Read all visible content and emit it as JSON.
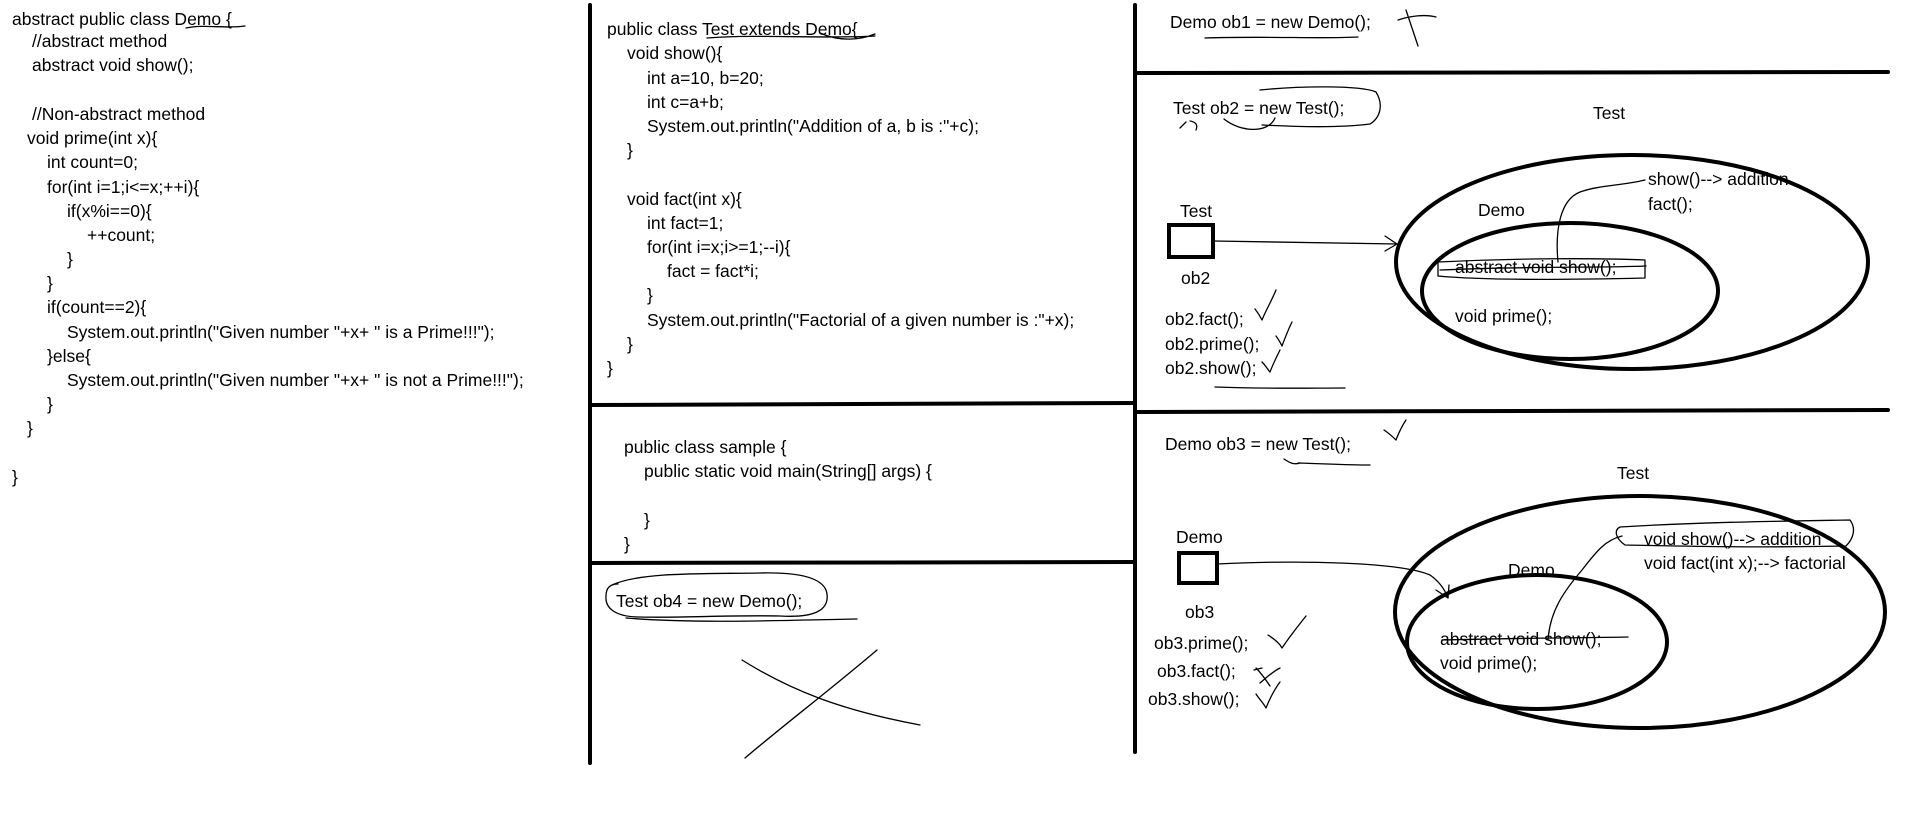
{
  "code_abstract_demo": [
    "abstract public class Demo {",
    "//abstract method",
    "abstract void show();",
    "//Non-abstract method",
    "void prime(int x){",
    "int count=0;",
    "for(int i=1;i<=x;++i){",
    "if(x%i==0){",
    "++count;",
    "}",
    "}",
    "if(count==2){",
    "System.out.println(\"Given number \"+x+ \" is a Prime!!!\");",
    "}else{",
    "System.out.println(\"Given number \"+x+ \" is not a Prime!!!\");",
    "}",
    "}",
    "}"
  ],
  "code_test_class": [
    "public class Test extends Demo{",
    "void show(){",
    "int a=10, b=20;",
    "int c=a+b;",
    "System.out.println(\"Addition of a, b is :\"+c);",
    "}",
    "void fact(int x){",
    "int fact=1;",
    "for(int i=x;i>=1;--i){",
    "fact = fact*i;",
    "}",
    "System.out.println(\"Factorial of a given number is :\"+x);",
    "}",
    "}"
  ],
  "code_sample_class": [
    "public class sample {",
    "public static void main(String[] args) {",
    "}",
    "}"
  ],
  "ob4_statement": "Test ob4 = new Demo();",
  "ob1_statement": "Demo ob1 = new Demo();",
  "ob2_section": {
    "statement": "Test ob2 = new Test();",
    "outer_label": "Test",
    "ref_type": "Test",
    "ref_name": "ob2",
    "inner_label": "Demo",
    "outer_methods": [
      "show()--> addition",
      "fact();"
    ],
    "inner_methods": [
      "abstract void show();",
      "void prime();"
    ],
    "calls": [
      "ob2.fact();",
      "ob2.prime();",
      "ob2.show();"
    ]
  },
  "ob3_section": {
    "statement": "Demo ob3 = new Test();",
    "outer_label": "Test",
    "ref_type": "Demo",
    "ref_name": "ob3",
    "inner_label": "Demo",
    "outer_methods": [
      "void show()--> addition",
      "void fact(int x);--> factorial"
    ],
    "inner_methods": [
      "abstract void show();",
      "void prime();"
    ],
    "calls": [
      "ob3.prime();",
      "ob3.fact();",
      "ob3.show();"
    ]
  }
}
